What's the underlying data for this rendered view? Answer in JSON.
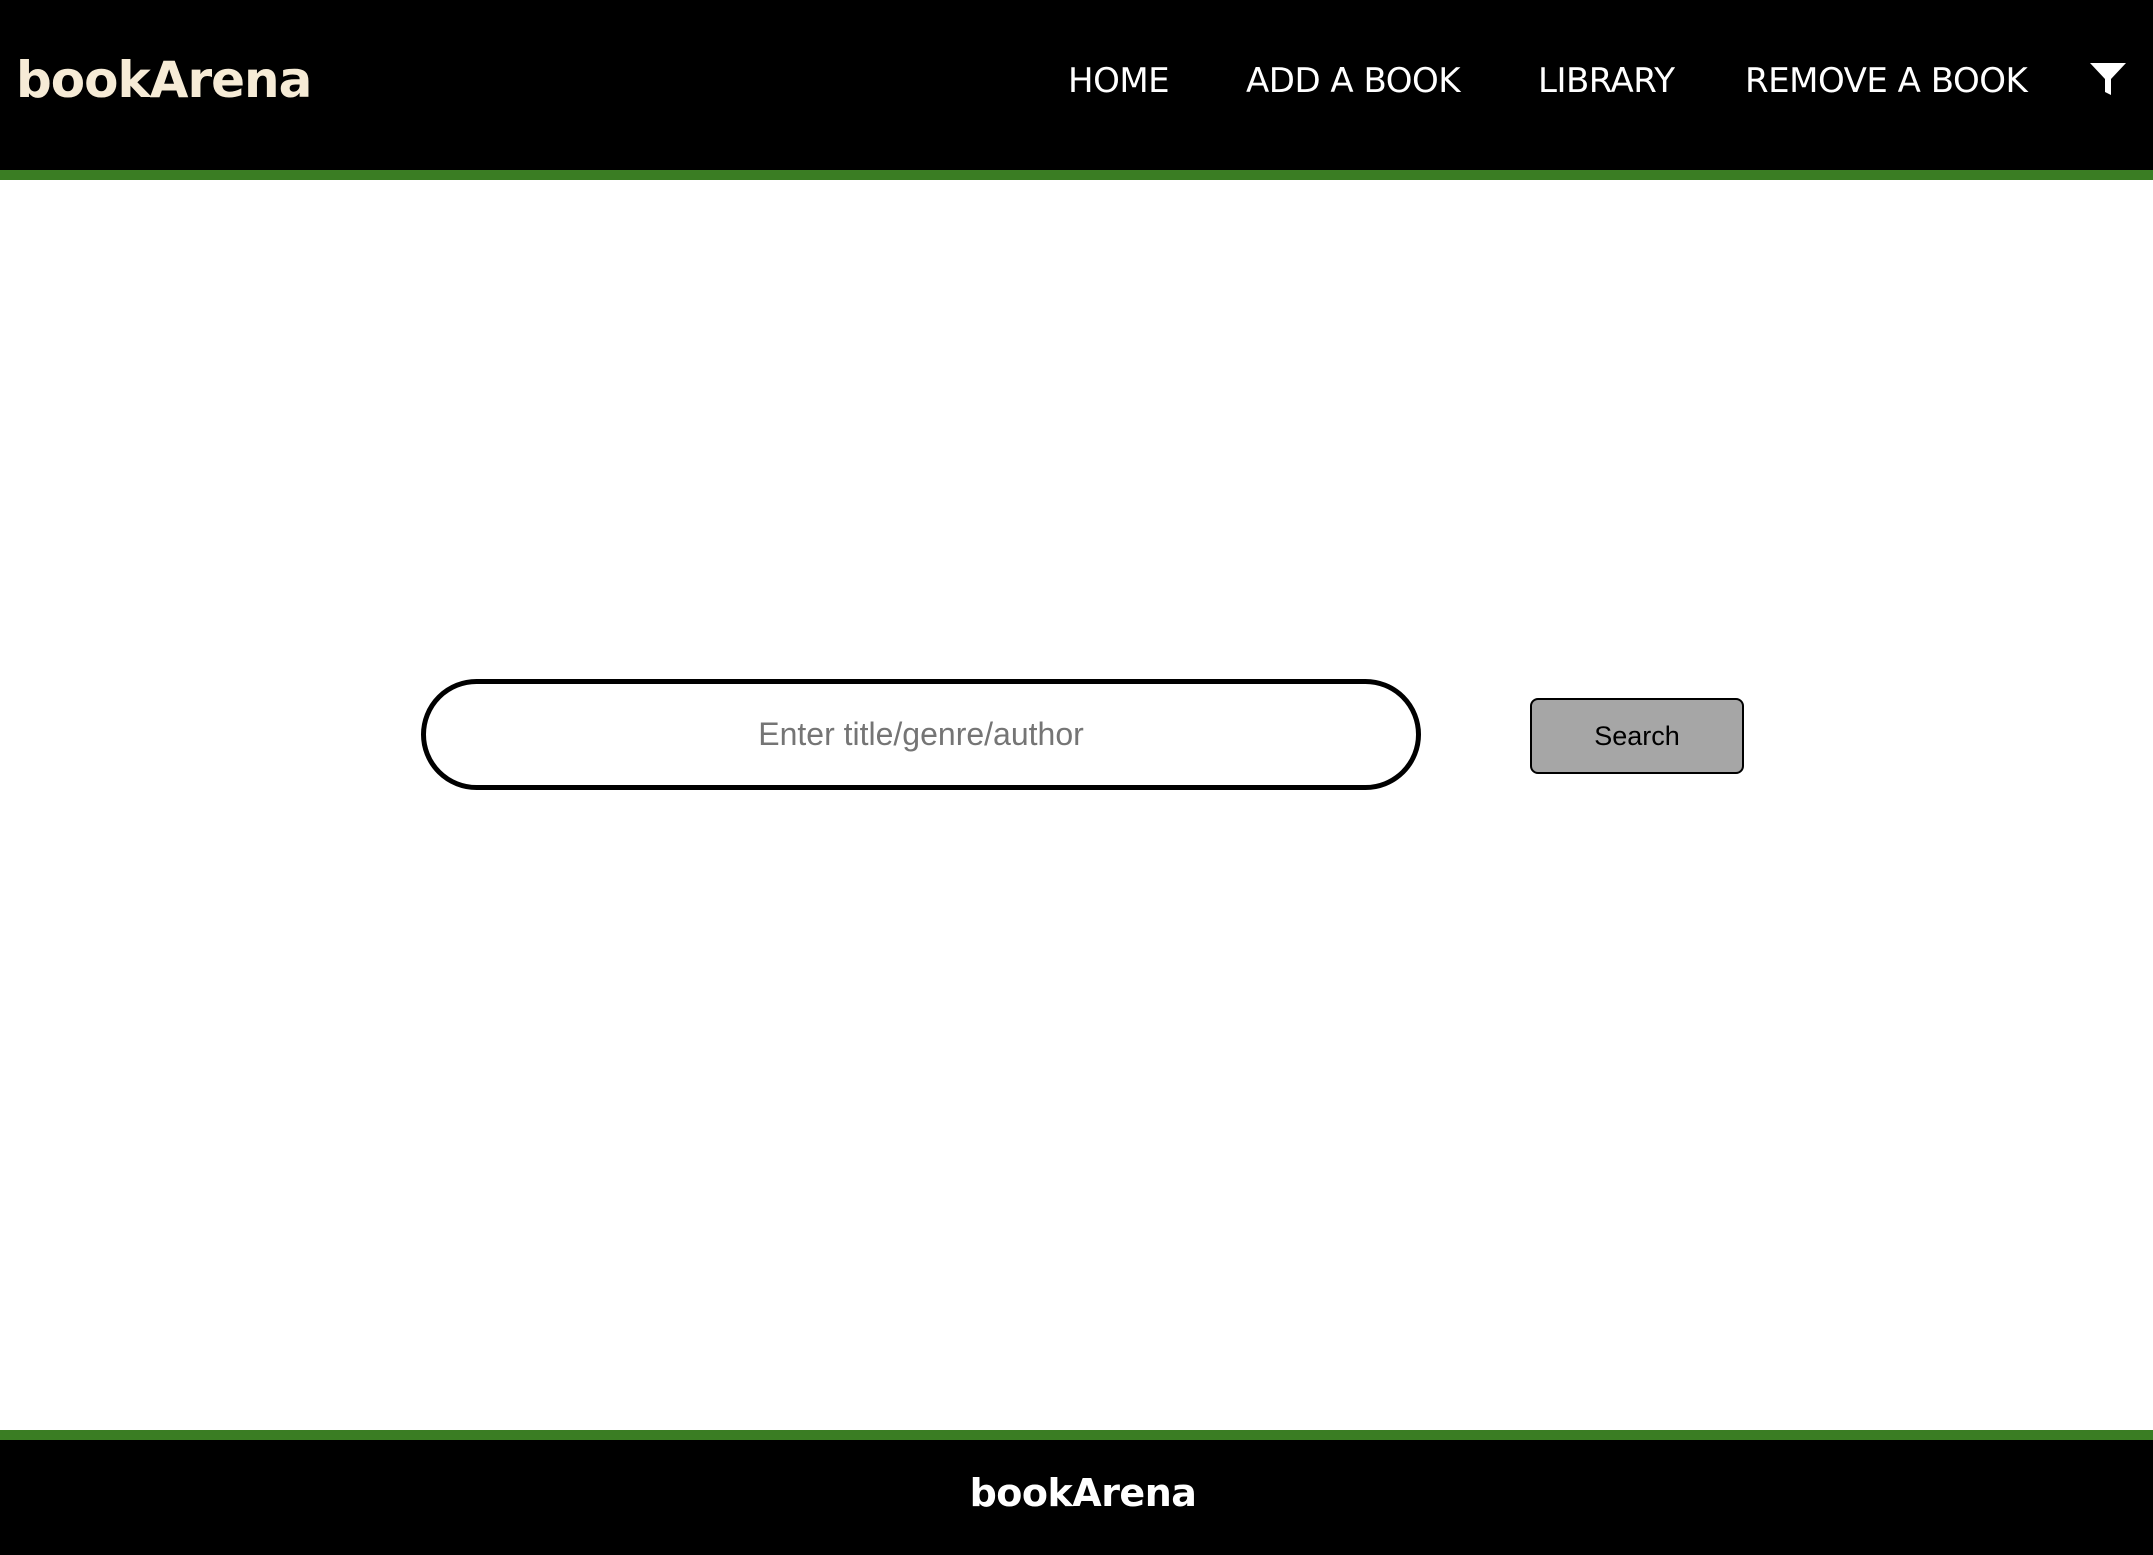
{
  "header": {
    "brand": "bookArena",
    "nav": [
      {
        "label": "HOME"
      },
      {
        "label": "ADD A BOOK"
      },
      {
        "label": "LIBRARY"
      },
      {
        "label": "REMOVE A BOOK"
      }
    ],
    "filter_icon": "filter-icon"
  },
  "search": {
    "placeholder": "Enter title/genre/author",
    "value": "",
    "button_label": "Search"
  },
  "footer": {
    "brand": "bookArena"
  },
  "colors": {
    "header_bg": "#000000",
    "accent_green": "#3a7d23",
    "brand_text": "#f6ebd6",
    "button_bg": "#a6a6a6"
  }
}
